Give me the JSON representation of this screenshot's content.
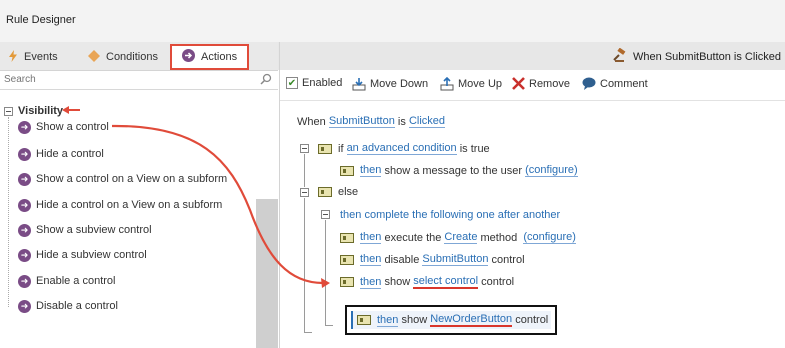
{
  "app": {
    "title": "Rule Designer"
  },
  "tabs": [
    {
      "label": "Events",
      "icon": "lightning-icon"
    },
    {
      "label": "Conditions",
      "icon": "diamond-icon"
    },
    {
      "label": "Actions",
      "icon": "arrow-circle-icon",
      "active": true
    }
  ],
  "search": {
    "placeholder": "Search"
  },
  "actions_tree": {
    "group": "Visibility",
    "items": [
      "Show a control",
      "Hide a control",
      "Show a control on a View on a subform",
      "Hide a control on a View on a subform",
      "Show a subview control",
      "Hide a subview control",
      "Enable a control",
      "Disable a control"
    ]
  },
  "event_header": {
    "label": "When SubmitButton is Clicked"
  },
  "toolbar": {
    "enabled": "Enabled",
    "move_down": "Move Down",
    "move_up": "Move Up",
    "remove": "Remove",
    "comment": "Comment"
  },
  "rule": {
    "when": {
      "prefix": "When",
      "control": "SubmitButton",
      "mid": "is",
      "event": "Clicked"
    },
    "if_line": {
      "prefix": "if",
      "condition": "an advanced condition",
      "suffix": "is true"
    },
    "if_action": {
      "then": "then",
      "text": "show a message to the user",
      "configure": "(configure)"
    },
    "else": "else",
    "sequence": "then complete the following one after another",
    "execute": {
      "then": "then",
      "pre": "execute the",
      "method": "Create",
      "post": "method",
      "configure": "(configure)"
    },
    "disable": {
      "then": "then",
      "pre": "disable",
      "control": "SubmitButton",
      "post": "control"
    },
    "show": {
      "then": "then",
      "pre": "show",
      "control": "select control",
      "post": "control"
    }
  },
  "callout": {
    "then": "then",
    "pre": "show",
    "control": "NewOrderButton",
    "post": "control"
  },
  "colors": {
    "accent_red": "#e04b3a",
    "link_blue": "#2a6fb5",
    "action_purple": "#7a4c86"
  }
}
